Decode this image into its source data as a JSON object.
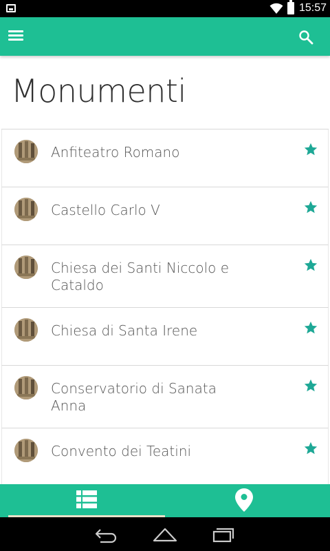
{
  "status_bar": {
    "time": "15:57",
    "icons": [
      "screenshot-icon",
      "wifi-icon",
      "battery-icon"
    ]
  },
  "app_bar": {
    "icons": [
      "menu-icon",
      "search-icon"
    ],
    "color": "#1ebf94"
  },
  "page": {
    "title": "Monumenti"
  },
  "monuments": [
    {
      "name": "Anfiteatro Romano",
      "favorite_icon": "star-icon"
    },
    {
      "name": "Castello Carlo V",
      "favorite_icon": "star-icon"
    },
    {
      "name": "Chiesa dei Santi Niccolo e Cataldo",
      "favorite_icon": "star-icon"
    },
    {
      "name": "Chiesa di Santa Irene",
      "favorite_icon": "star-icon"
    },
    {
      "name": "Conservatorio di Sanata Anna",
      "favorite_icon": "star-icon"
    },
    {
      "name": "Convento dei Teatini",
      "favorite_icon": "star-icon"
    }
  ],
  "bottom_tabs": [
    {
      "icon": "list-icon",
      "selected": true
    },
    {
      "icon": "map-pin-icon",
      "selected": false
    }
  ],
  "nav_bar": {
    "icons": [
      "back-icon",
      "home-icon",
      "recents-icon"
    ]
  },
  "colors": {
    "accent": "#1ebf94",
    "star": "#1ea896",
    "text": "#555555",
    "title": "#2f2f2f"
  }
}
